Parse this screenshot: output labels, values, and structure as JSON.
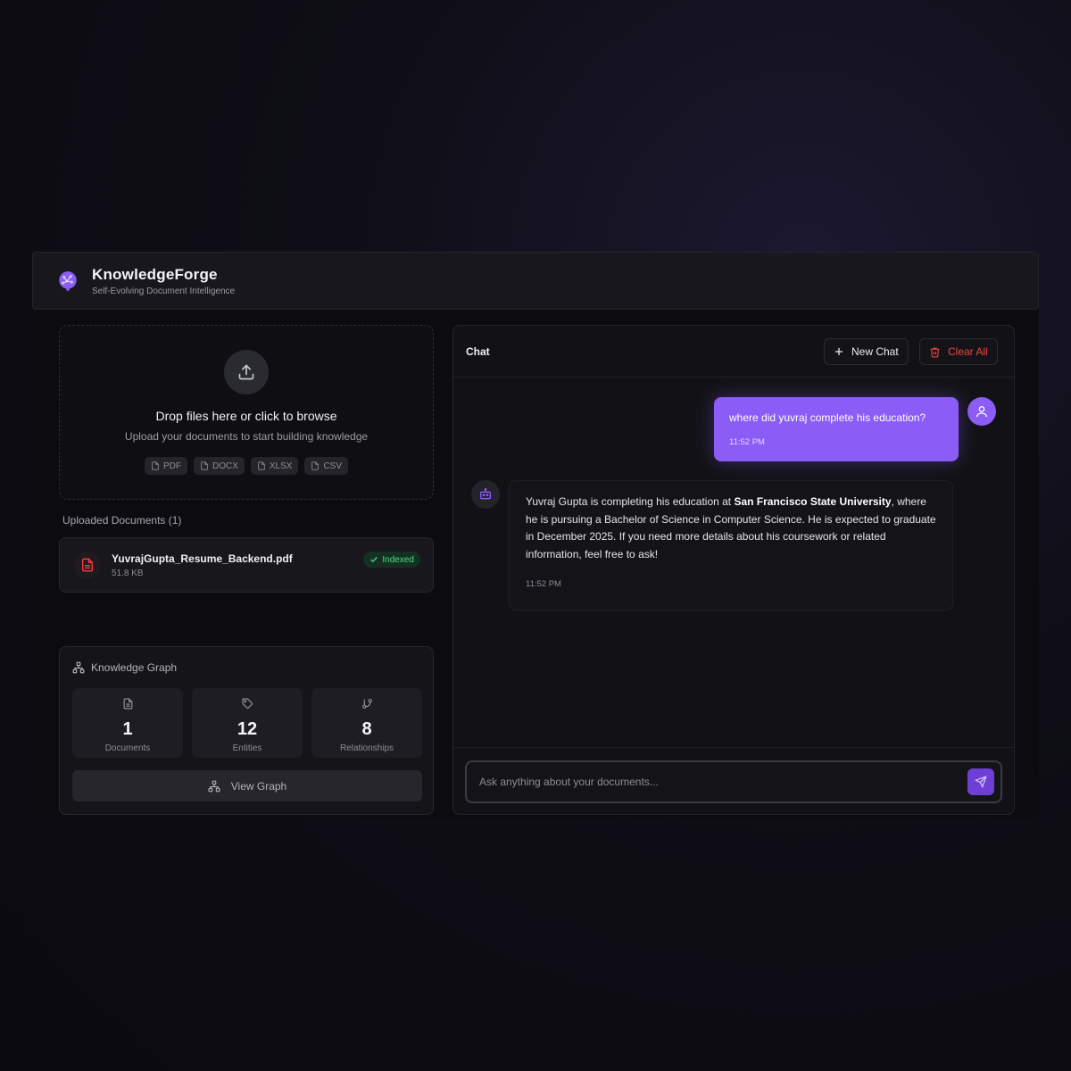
{
  "header": {
    "title": "KnowledgeForge",
    "subtitle": "Self-Evolving Document Intelligence"
  },
  "upload": {
    "title": "Drop files here or click to browse",
    "subtitle": "Upload your documents to start building knowledge",
    "formats": [
      "PDF",
      "DOCX",
      "XLSX",
      "CSV"
    ]
  },
  "documents": {
    "label": "Uploaded Documents (1)",
    "items": [
      {
        "name": "YuvrajGupta_Resume_Backend.pdf",
        "size": "51.8 KB",
        "status": "Indexed"
      }
    ]
  },
  "knowledge_graph": {
    "title": "Knowledge Graph",
    "stats": [
      {
        "value": "1",
        "label": "Documents",
        "icon": "file-icon"
      },
      {
        "value": "12",
        "label": "Entities",
        "icon": "tags-icon"
      },
      {
        "value": "8",
        "label": "Relationships",
        "icon": "git-branch-icon"
      }
    ],
    "view_button": "View Graph"
  },
  "chat": {
    "title": "Chat",
    "new_chat": "New Chat",
    "clear_all": "Clear All",
    "messages": [
      {
        "role": "user",
        "text": "where did yuvraj complete his education?",
        "time": "11:52 PM"
      },
      {
        "role": "assistant",
        "text_before": "Yuvraj Gupta is completing his education at ",
        "text_bold": "San Francisco State University",
        "text_after": ", where he is pursuing a Bachelor of Science in Computer Science. He is expected to graduate in December 2025. If you need more details about his coursework or related information, feel free to ask!",
        "time": "11:52 PM"
      }
    ],
    "input_placeholder": "Ask anything about your documents..."
  },
  "colors": {
    "accent": "#8b5cf6",
    "danger": "#ef4444",
    "success": "#4ade80"
  }
}
